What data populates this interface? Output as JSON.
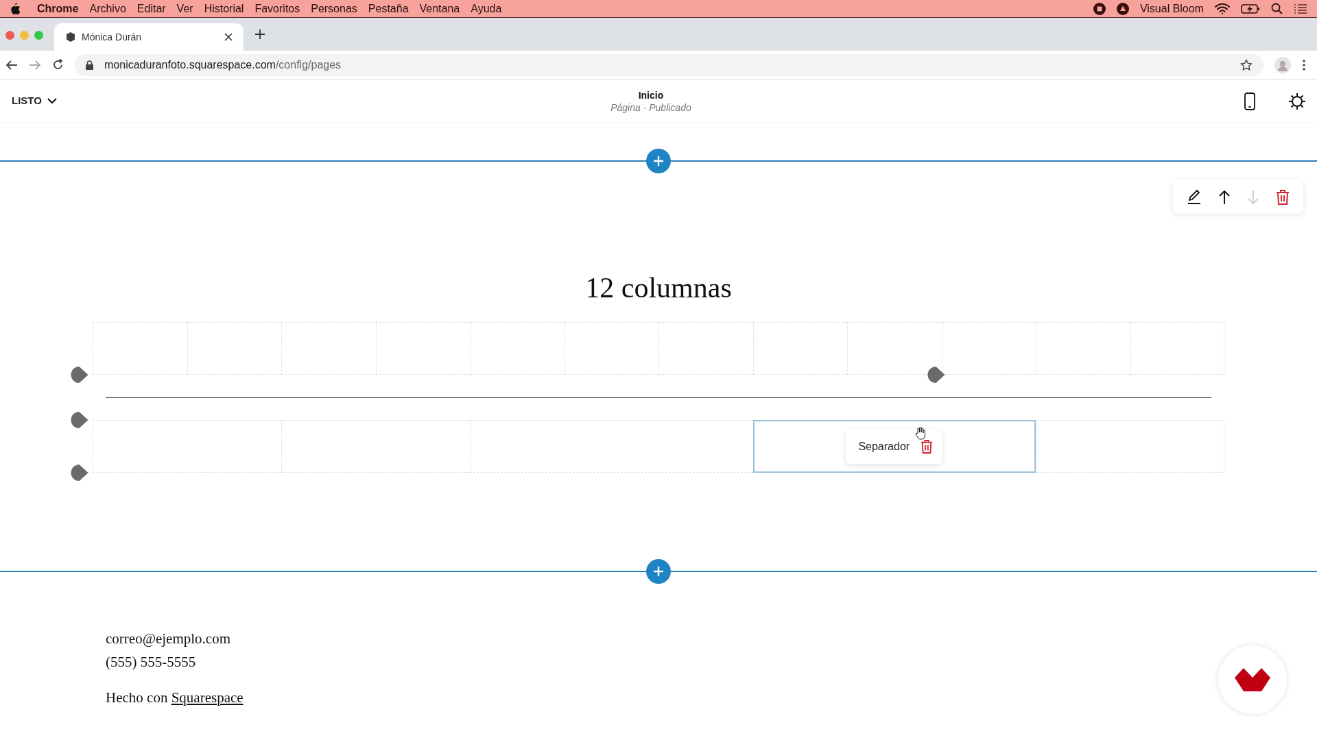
{
  "menu_bar": {
    "app": "Chrome",
    "items": [
      "Archivo",
      "Editar",
      "Ver",
      "Historial",
      "Favoritos",
      "Personas",
      "Pestaña",
      "Ventana",
      "Ayuda"
    ],
    "status_text": "Visual Bloom"
  },
  "tabs": [
    {
      "label": "Mónica Durán",
      "selected": true
    }
  ],
  "address_bar": {
    "host": "monicaduranfoto.squarespace.com",
    "path": "/config/pages"
  },
  "editor_header": {
    "done_label": "LISTO",
    "page_title": "Inicio",
    "page_status": "Página · Publicado"
  },
  "section": {
    "heading": "12 columnas",
    "toolbar": [
      {
        "kind": "edit",
        "disabled": false
      },
      {
        "kind": "up",
        "disabled": false
      },
      {
        "kind": "down",
        "disabled": true
      },
      {
        "kind": "delete",
        "disabled": false
      }
    ],
    "block": {
      "label": "Separador",
      "selected": true
    }
  },
  "footer": {
    "email": "correo@ejemplo.com",
    "phone": "(555) 555-5555",
    "credit": "Hecho con",
    "credit_link": "Squarespace"
  }
}
